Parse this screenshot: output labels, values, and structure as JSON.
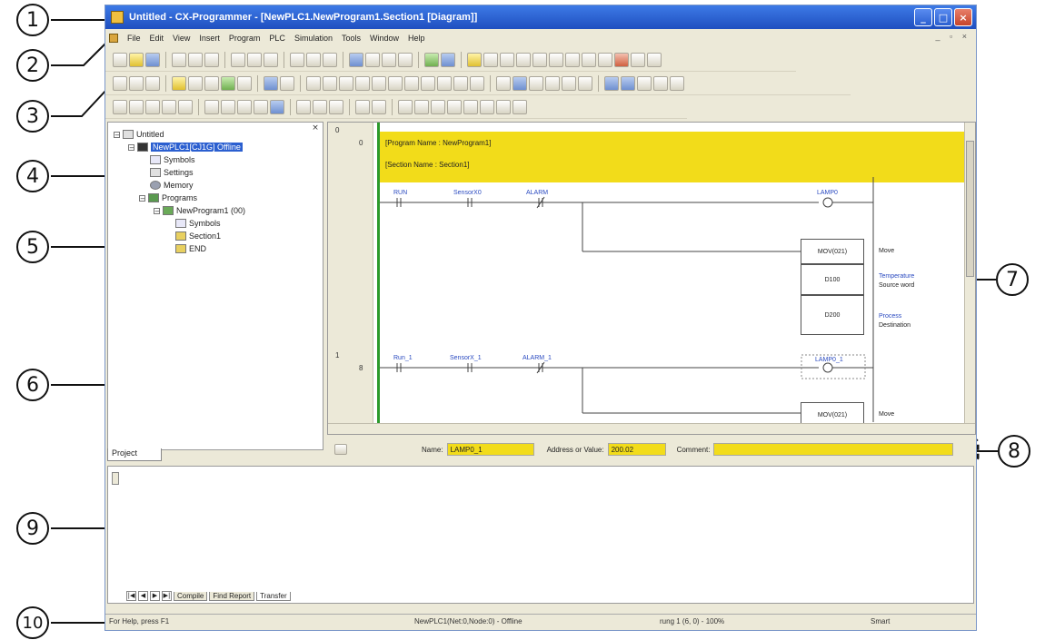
{
  "window": {
    "title": "Untitled - CX-Programmer - [NewPLC1.NewProgram1.Section1 [Diagram]]",
    "min": "_",
    "max": "□",
    "close": "×"
  },
  "menubar": {
    "items": [
      "File",
      "Edit",
      "View",
      "Insert",
      "Program",
      "PLC",
      "Simulation",
      "Tools",
      "Window",
      "Help"
    ],
    "mdi_buttons": "_ ▫ ×"
  },
  "project_tree": {
    "root": "Untitled",
    "plc": "NewPLC1[CJ1G] Offline",
    "items": [
      "Symbols",
      "Settings",
      "Memory",
      "Programs"
    ],
    "program": "NewProgram1 (00)",
    "program_items": [
      "Symbols",
      "Section1",
      "END"
    ],
    "tab_label": "Project"
  },
  "diagram": {
    "header_line1": "[Program Name : NewProgram1]",
    "header_line2": "[Section Name : Section1]",
    "rung0": {
      "number": "0",
      "step": "0",
      "contact1": "RUN",
      "contact2": "SensorX0",
      "contact3": "ALARM",
      "coil": "LAMP0",
      "instruction": "MOV(021)",
      "instruction_desc": "Move",
      "operand1": "D100",
      "operand1_symbol": "Temperature",
      "operand1_desc": "Source word",
      "operand2": "D200",
      "operand2_symbol": "Process",
      "operand2_desc": "Destination"
    },
    "rung1": {
      "number": "1",
      "step": "8",
      "contact1": "Run_1",
      "contact2": "SensorX_1",
      "contact3": "ALARM_1",
      "coil": "LAMP0_1",
      "instruction": "MOV(021)",
      "instruction_desc": "Move"
    }
  },
  "address_bar": {
    "name_label": "Name:",
    "name_value": "LAMP0_1",
    "address_label": "Address or Value:",
    "address_value": "200.02",
    "comment_label": "Comment:",
    "comment_value": ""
  },
  "output": {
    "tabs": [
      "Compile",
      "Find Report",
      "Transfer"
    ],
    "active_tab": "Transfer",
    "nav": [
      "|◀",
      "◀",
      "▶",
      "▶|"
    ]
  },
  "statusbar": {
    "help": "For Help, press F1",
    "plc": "NewPLC1(Net:0,Node:0) - Offline",
    "rung": "rung 1 (6, 0) - 100%",
    "mode": "Smart"
  },
  "callouts": [
    "1",
    "2",
    "3",
    "4",
    "5",
    "6",
    "7",
    "8",
    "9",
    "10"
  ],
  "colors": {
    "highlight": "#f2dc1a",
    "rail": "#2c9a2c",
    "titlebar": "#2b5fd0"
  }
}
